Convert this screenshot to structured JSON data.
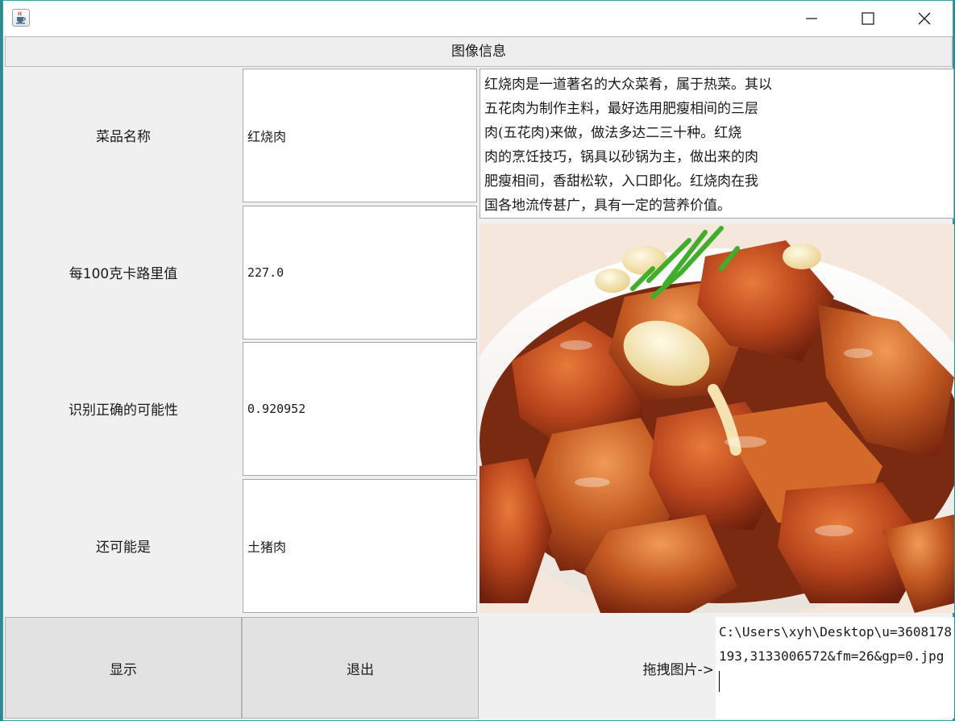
{
  "window": {
    "icon": "java-cup-icon",
    "controls": [
      "minimize-icon",
      "maximize-icon",
      "close-icon"
    ]
  },
  "header": {
    "title": "图像信息"
  },
  "fields": [
    {
      "label": "菜品名称",
      "value": "红烧肉"
    },
    {
      "label": "每100克卡路里值",
      "value": "227.0"
    },
    {
      "label": "识别正确的可能性",
      "value": "0.920952"
    },
    {
      "label": "还可能是",
      "value": "土猪肉"
    }
  ],
  "description": {
    "lines": [
      "红烧肉是一道著名的大众菜肴，属于热菜。其以",
      "五花肉为制作主料，最好选用肥瘦相间的三层",
      "肉(五花肉)来做，做法多达二三十种。红烧",
      "肉的烹饪技巧，锅具以砂锅为主，做出来的肉",
      "肥瘦相间，香甜松软，入口即化。红烧肉在我",
      "国各地流传甚广，具有一定的营养价值。"
    ]
  },
  "buttons": {
    "show": "显示",
    "exit": "退出"
  },
  "drag": {
    "label": "拖拽图片->",
    "path": "C:\\Users\\xyh\\Desktop\\u=3608178193,3133006572&fm=26&gp=0.jpg"
  }
}
